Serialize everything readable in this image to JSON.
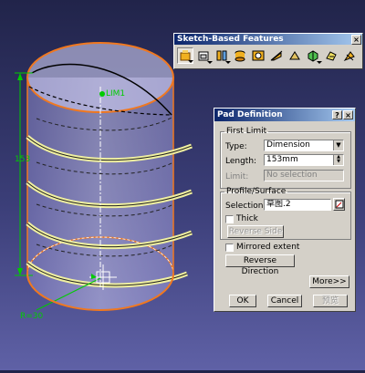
{
  "toolbar": {
    "title": "Sketch-Based Features",
    "close_glyph": "×",
    "icons": [
      "pad-icon",
      "drafted-pad-icon",
      "pocket-icon",
      "shaft-icon",
      "hole-icon",
      "rib-icon",
      "stiffener-icon",
      "multi-section-icon",
      "remove-multi-section-icon",
      "solid-combine-icon"
    ]
  },
  "dialog": {
    "title": "Pad Definition",
    "help_glyph": "?",
    "close_glyph": "×",
    "first_limit": {
      "legend": "First Limit",
      "type_label": "Type:",
      "type_value": "Dimension",
      "length_label": "Length:",
      "length_value": "153mm",
      "limit_label": "Limit:",
      "limit_value": "No selection"
    },
    "profile": {
      "legend": "Profile/Surface",
      "selection_label": "Selection:",
      "selection_value": "草图.2",
      "thick_label": "Thick",
      "reverse_side_label": "Reverse Side"
    },
    "mirrored_label": "Mirrored extent",
    "reverse_direction_label": "Reverse Direction",
    "more_label": "More>>",
    "ok_label": "OK",
    "cancel_label": "Cancel",
    "preview_label": "预览"
  },
  "viewport": {
    "dimension_label": "153",
    "point_label": "LIM1",
    "radius_label": "R=30"
  },
  "colors": {
    "background_top": "#21244a",
    "background_bottom": "#5f61a6",
    "edge_highlight": "#f07820",
    "dimension": "#00cc00"
  }
}
